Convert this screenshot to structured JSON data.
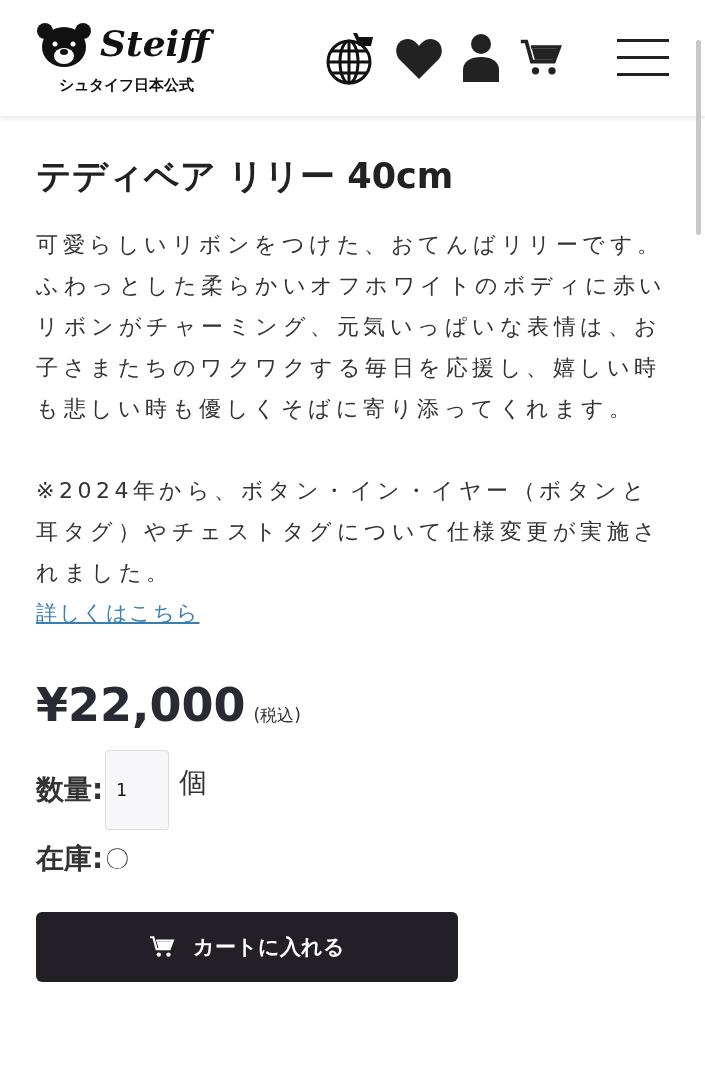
{
  "header": {
    "brand": "Steiff",
    "subtitle": "シュタイフ日本公式"
  },
  "product": {
    "title": "テディベア リリー 40cm",
    "description": "可愛らしいリボンをつけた、おてんばリリーです。ふわっとした柔らかいオフホワイトのボディに赤いリボンがチャーミング、元気いっぱいな表情は、お子さまたちのワクワクする毎日を応援し、嬉しい時も悲しい時も優しくそばに寄り添ってくれます。",
    "notice": "※2024年から、ボタン・イン・イヤー（ボタンと耳タグ）やチェストタグについて仕様変更が実施されました。",
    "link": "詳しくはこちら",
    "price": "¥22,000",
    "tax_note": "(税込)",
    "quantity_label": "数量:",
    "quantity": "1",
    "quantity_unit": "個",
    "stock_label": "在庫:",
    "stock": "〇",
    "add_to_cart": "カートに入れる"
  }
}
